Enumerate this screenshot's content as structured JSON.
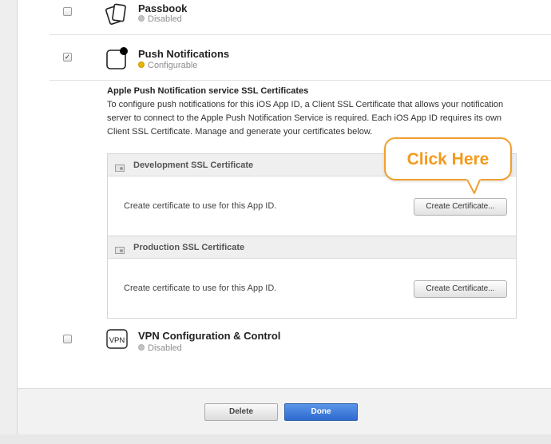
{
  "services": [
    {
      "name": "Passbook",
      "status": "Disabled",
      "checked": false,
      "icon": "passbook-icon",
      "status_color": "#c2c2c2"
    },
    {
      "name": "Push Notifications",
      "status": "Configurable",
      "checked": true,
      "icon": "push-notifications-icon",
      "status_color": "#e7b400"
    },
    {
      "name": "VPN Configuration & Control",
      "status": "Disabled",
      "checked": false,
      "icon": "vpn-icon",
      "icon_text": "VPN",
      "status_color": "#c2c2c2"
    }
  ],
  "ssl": {
    "heading": "Apple Push Notification service SSL Certificates",
    "description": "To configure push notifications for this iOS App ID, a Client SSL Certificate that allows your notification server to connect to the Apple Push Notification Service is required. Each iOS App ID requires its own Client SSL Certificate. Manage and generate your certificates below.",
    "certificates": [
      {
        "title": "Development SSL Certificate",
        "text": "Create certificate to use for this App ID.",
        "button": "Create Certificate..."
      },
      {
        "title": "Production SSL Certificate",
        "text": "Create certificate to use for this App ID.",
        "button": "Create Certificate..."
      }
    ]
  },
  "callout": {
    "text": "Click Here",
    "color": "#f39a1e"
  },
  "footer": {
    "delete_label": "Delete",
    "done_label": "Done"
  },
  "colors": {
    "done_button": "#2e6ad1",
    "callout_border": "#f0a030"
  }
}
